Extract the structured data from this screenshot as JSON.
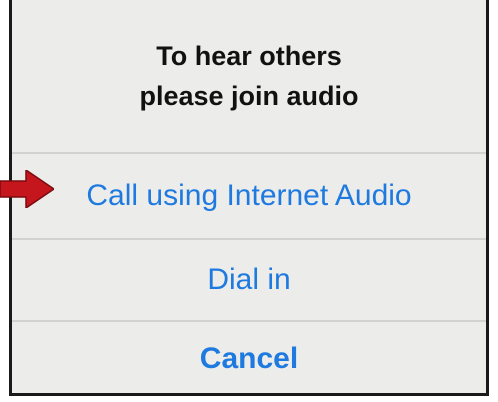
{
  "dialog": {
    "title_line1": "To hear others",
    "title_line2": "please join audio"
  },
  "actions": {
    "internet_audio_label": "Call using Internet Audio",
    "dial_in_label": "Dial in",
    "cancel_label": "Cancel"
  },
  "colors": {
    "accent": "#1f7ae0",
    "background": "#ececea",
    "divider": "#d2d2d0",
    "arrow": "#c4161c",
    "border": "#1a1a1a"
  },
  "icons": {
    "pointer": "red-arrow-icon"
  }
}
